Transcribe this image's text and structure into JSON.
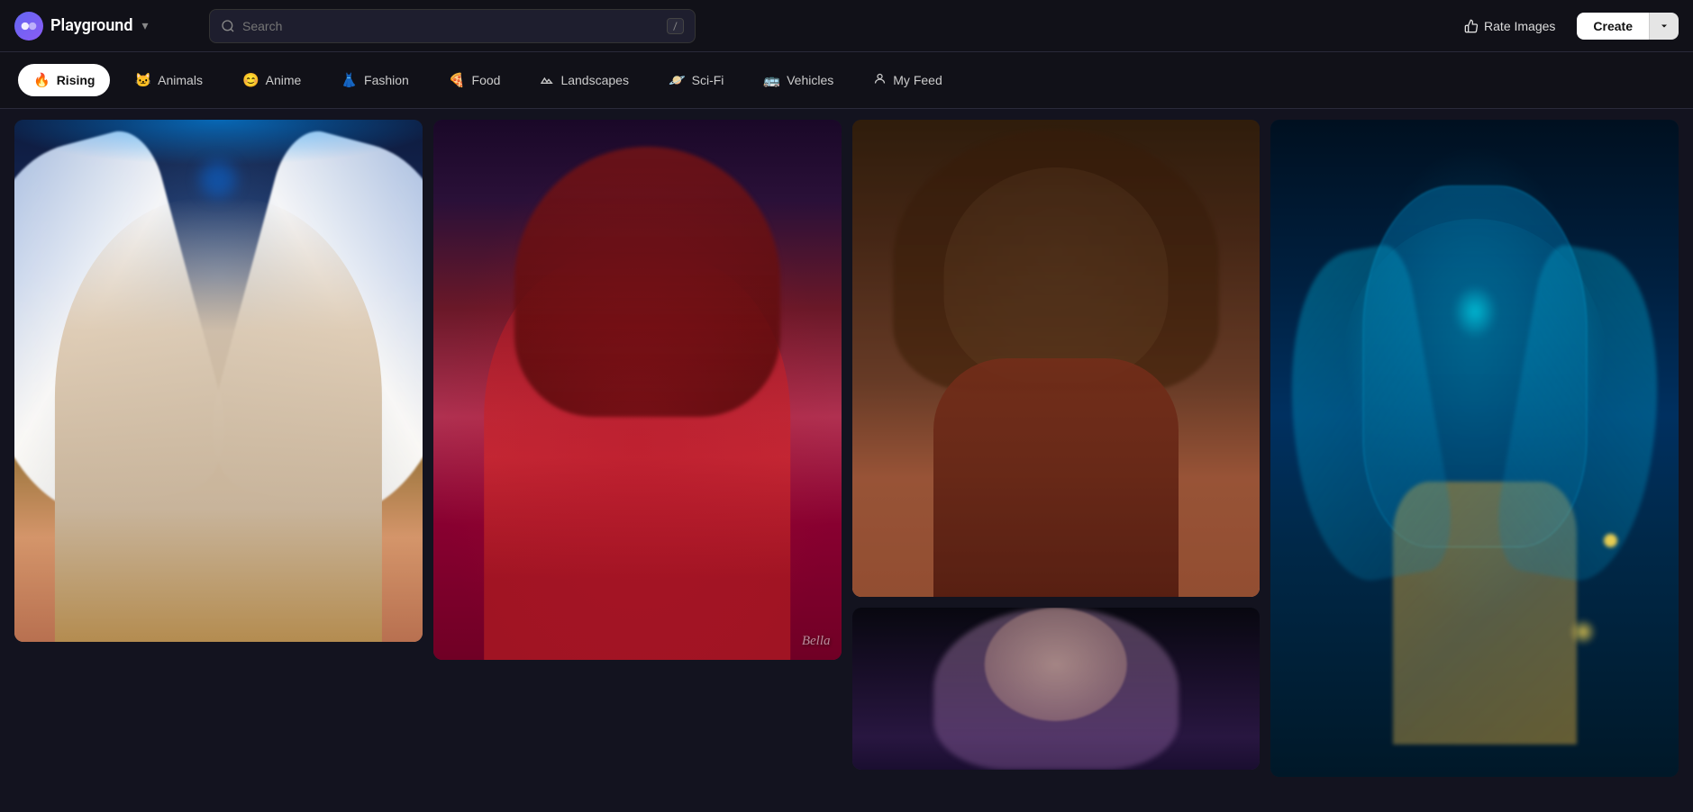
{
  "app": {
    "name": "Playground",
    "logo_symbol": "◑"
  },
  "header": {
    "search_placeholder": "Search",
    "search_shortcut": "/",
    "rate_images_label": "Rate Images",
    "create_label": "Create",
    "dropdown_label": "▾"
  },
  "nav": {
    "tabs": [
      {
        "id": "rising",
        "label": "Rising",
        "icon": "🔥",
        "active": true
      },
      {
        "id": "animals",
        "label": "Animals",
        "icon": "🐱"
      },
      {
        "id": "anime",
        "label": "Anime",
        "icon": "😊"
      },
      {
        "id": "fashion",
        "label": "Fashion",
        "icon": "👗"
      },
      {
        "id": "food",
        "label": "Food",
        "icon": "🍕"
      },
      {
        "id": "landscapes",
        "label": "Landscapes",
        "icon": "△"
      },
      {
        "id": "scifi",
        "label": "Sci-Fi",
        "icon": "🪐"
      },
      {
        "id": "vehicles",
        "label": "Vehicles",
        "icon": "🚌"
      },
      {
        "id": "myfeed",
        "label": "My Feed",
        "icon": "👤"
      }
    ]
  },
  "images": {
    "col1": [
      {
        "id": "angel",
        "alt": "Angel warrior figure with white wings",
        "watermark": ""
      }
    ],
    "col2": [
      {
        "id": "red-woman",
        "alt": "Woman in red outfit with dark hair",
        "watermark": "Bella"
      }
    ],
    "col3": [
      {
        "id": "portrait",
        "alt": "Portrait of woman with curly hair and jewelry",
        "watermark": ""
      },
      {
        "id": "dark-woman",
        "alt": "Dark haired woman portrait",
        "watermark": ""
      }
    ],
    "col4": [
      {
        "id": "robot",
        "alt": "Cyan robot figure with wings",
        "watermark": ""
      }
    ]
  }
}
